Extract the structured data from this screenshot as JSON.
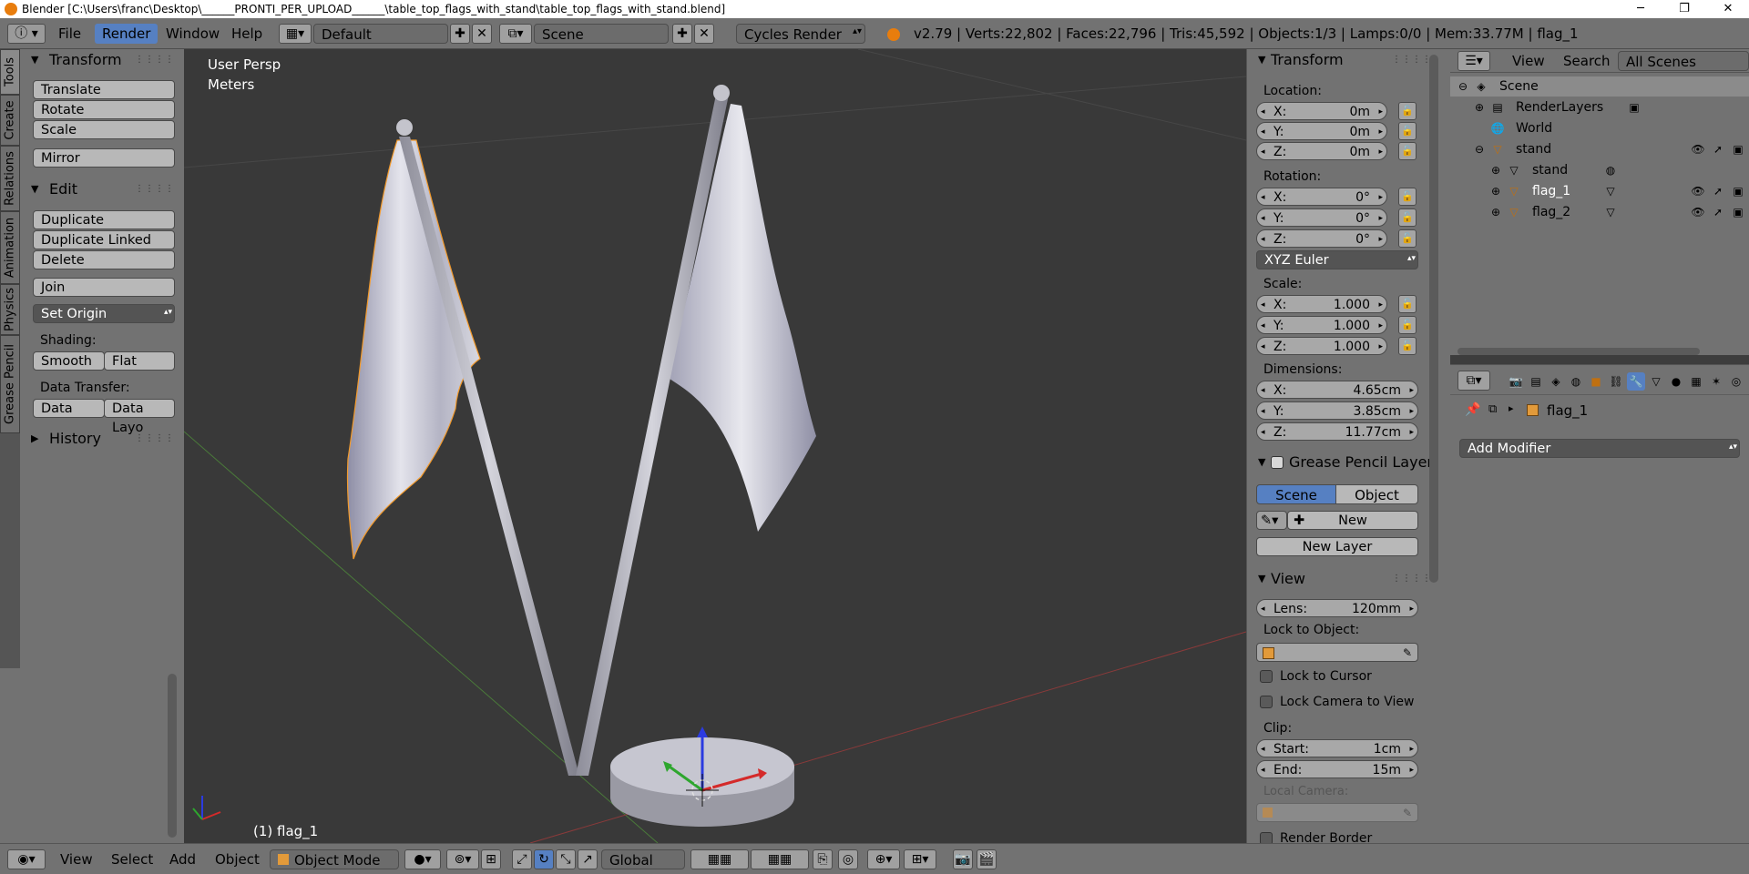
{
  "window": {
    "title": "Blender [C:\\Users\\franc\\Desktop\\______PRONTI_PER_UPLOAD______\\table_top_flags_with_stand\\table_top_flags_with_stand.blend]",
    "minimize": "─",
    "maximize": "❐",
    "close": "✕"
  },
  "header": {
    "menus": [
      "File",
      "Render",
      "Window",
      "Help"
    ],
    "active_menu": "Render",
    "screen_layout": "Default",
    "scene": "Scene",
    "render_engine": "Cycles Render",
    "stats": "v2.79 | Verts:22,802 | Faces:22,796 | Tris:45,592 | Objects:1/3 | Lamps:0/0 | Mem:33.77M | flag_1"
  },
  "left_tabs": [
    "Tools",
    "Create",
    "Relations",
    "Animation",
    "Physics",
    "Grease Pencil"
  ],
  "tool_shelf": {
    "transform": {
      "title": "Transform",
      "buttons": [
        "Translate",
        "Rotate",
        "Scale",
        "Mirror"
      ]
    },
    "edit": {
      "title": "Edit",
      "buttons": [
        "Duplicate",
        "Duplicate Linked",
        "Delete",
        "Join"
      ],
      "set_origin": "Set Origin",
      "shading_label": "Shading:",
      "shading_buttons": [
        "Smooth",
        "Flat"
      ],
      "data_transfer_label": "Data Transfer:",
      "data_transfer_buttons": [
        "Data",
        "Data Layo"
      ]
    },
    "history": {
      "title": "History"
    }
  },
  "viewport": {
    "view_name": "User Persp",
    "units": "Meters",
    "active_object_label": "(1) flag_1"
  },
  "n_panel": {
    "transform": {
      "title": "Transform",
      "location_label": "Location:",
      "location": [
        {
          "axis": "X:",
          "value": "0m"
        },
        {
          "axis": "Y:",
          "value": "0m"
        },
        {
          "axis": "Z:",
          "value": "0m"
        }
      ],
      "rotation_label": "Rotation:",
      "rotation": [
        {
          "axis": "X:",
          "value": "0°"
        },
        {
          "axis": "Y:",
          "value": "0°"
        },
        {
          "axis": "Z:",
          "value": "0°"
        }
      ],
      "rotation_mode": "XYZ Euler",
      "scale_label": "Scale:",
      "scale": [
        {
          "axis": "X:",
          "value": "1.000"
        },
        {
          "axis": "Y:",
          "value": "1.000"
        },
        {
          "axis": "Z:",
          "value": "1.000"
        }
      ],
      "dimensions_label": "Dimensions:",
      "dimensions": [
        {
          "axis": "X:",
          "value": "4.65cm"
        },
        {
          "axis": "Y:",
          "value": "3.85cm"
        },
        {
          "axis": "Z:",
          "value": "11.77cm"
        }
      ]
    },
    "grease_pencil": {
      "title": "Grease Pencil Layer",
      "tabs": [
        "Scene",
        "Object"
      ],
      "new_label": "New",
      "new_layer_label": "New Layer"
    },
    "view": {
      "title": "View",
      "lens_label": "Lens:",
      "lens_value": "120mm",
      "lock_to_object_label": "Lock to Object:",
      "lock_to_cursor": "Lock to Cursor",
      "lock_camera": "Lock Camera to View",
      "clip_label": "Clip:",
      "clip_start_label": "Start:",
      "clip_start_value": "1cm",
      "clip_end_label": "End:",
      "clip_end_value": "15m",
      "local_camera_label": "Local Camera:",
      "render_border": "Render Border"
    }
  },
  "outliner": {
    "menus": [
      "View",
      "Search"
    ],
    "display_mode": "All Scenes",
    "items": [
      {
        "name": "Scene"
      },
      {
        "name": "RenderLayers"
      },
      {
        "name": "World"
      },
      {
        "name": "stand"
      },
      {
        "name": "stand"
      },
      {
        "name": "flag_1"
      },
      {
        "name": "flag_2"
      }
    ]
  },
  "properties": {
    "object_name": "flag_1",
    "add_modifier": "Add Modifier"
  },
  "bottom_bar": {
    "menus": [
      "View",
      "Select",
      "Add",
      "Object"
    ],
    "mode": "Object Mode",
    "orientation": "Global"
  },
  "colors": {
    "accent_blue": "#5680c2",
    "panel_bg": "#727272",
    "viewport_bg": "#393939",
    "selection_orange": "#f39a2b"
  }
}
